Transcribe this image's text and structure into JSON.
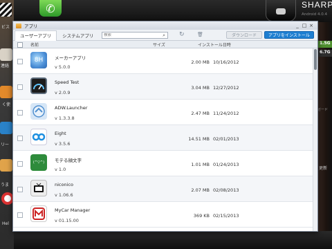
{
  "background": {
    "device_brand": "SHARP",
    "device_os": "Android 4.0.4",
    "storage_1": "1.5G",
    "storage_2": "6.7G",
    "side_label_1": "ビス",
    "side_label_2": "連絡",
    "side_label_3": "く使",
    "side_label_4": "リー",
    "side_label_5": "うま",
    "side_label_6": "Hel",
    "refresh_label": "更新",
    "card_label": "ガード"
  },
  "window": {
    "title": "アプリ",
    "minimize": "_",
    "maximize": "□",
    "close": "×"
  },
  "toolbar": {
    "tab_user": "ユーザーアプリ",
    "tab_system": "システムアプリ",
    "search_placeholder": "検索",
    "download_label": "ダウンロード",
    "install_label": "アプリをインストール"
  },
  "columns": {
    "name": "名前",
    "size": "サイズ",
    "install_date": "インストール日時"
  },
  "apps": [
    {
      "name": "メーカーアプリ",
      "version": "v 5.0.0",
      "size": "2.00 MB",
      "date": "10/16/2012",
      "icon": "carrier-app-icon"
    },
    {
      "name": "Speed Test",
      "version": "v 2.0.9",
      "size": "3.04 MB",
      "date": "12/27/2012",
      "icon": "speedometer-icon"
    },
    {
      "name": "ADW.Launcher",
      "version": "v 1.3.3.8",
      "size": "2.47 MB",
      "date": "11/24/2012",
      "icon": "launcher-home-icon"
    },
    {
      "name": "Eight",
      "version": "v 3.5.6",
      "size": "14.51 MB",
      "date": "02/01/2013",
      "icon": "eight-infinity-icon"
    },
    {
      "name": "モテる顔文字",
      "version": "v 1.0",
      "size": "1.01 MB",
      "date": "01/24/2013",
      "icon": "kaomoji-icon"
    },
    {
      "name": "niconico",
      "version": "v 1.06.6",
      "size": "2.07 MB",
      "date": "02/08/2013",
      "icon": "niconico-tv-icon"
    },
    {
      "name": "MyCar Manager",
      "version": "v 01.15.00",
      "size": "369 KB",
      "date": "02/15/2013",
      "icon": "mycar-icon"
    }
  ],
  "glyphs": {
    "search": "⌕",
    "refresh": "↻",
    "delete": "🗑",
    "phone": "✆",
    "carrier": "8H",
    "launcher": "⌂",
    "eight": "∞",
    "kaomoji": "(^▽^)",
    "tv": "▶",
    "mycar": "M"
  },
  "colors": {
    "accent": "#1f7fd1",
    "phone_app": "#4cbf3f"
  }
}
